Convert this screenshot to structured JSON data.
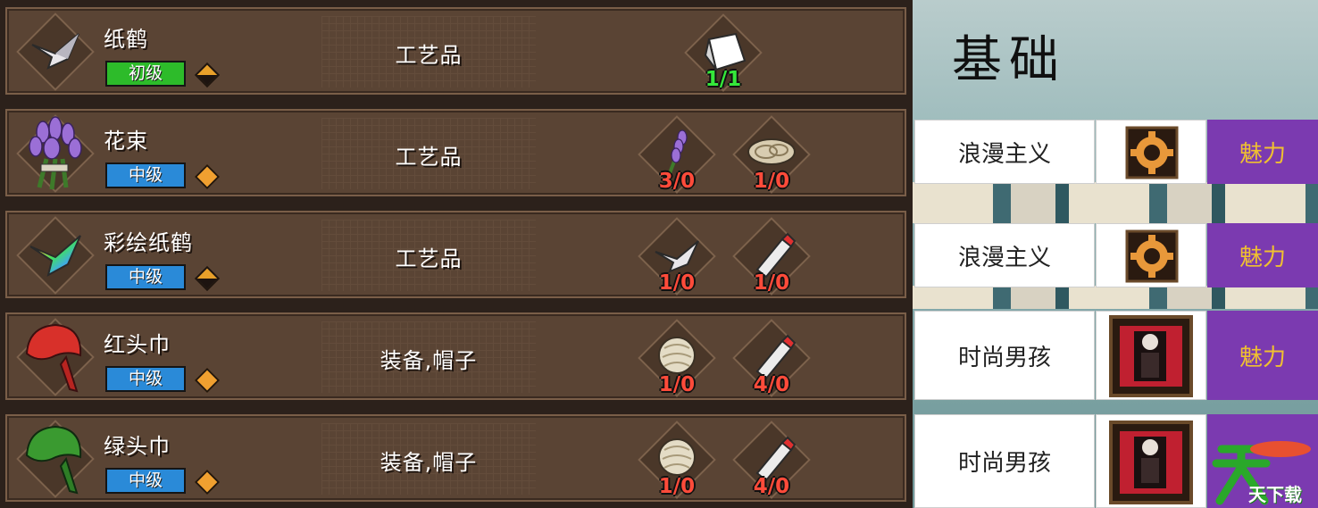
{
  "recipes": [
    {
      "name": "纸鹤",
      "tier": "初级",
      "tier_color": "#2dbb2a",
      "category": "工艺品",
      "icon": "paper-crane-icon",
      "ingredients": [
        {
          "icon": "paper-sheet-icon",
          "count": "1/1",
          "enough": true
        }
      ]
    },
    {
      "name": "花束",
      "tier": "中级",
      "tier_color": "#2a8ad8",
      "category": "工艺品",
      "icon": "lavender-bouquet-icon",
      "ingredients": [
        {
          "icon": "lavender-icon",
          "count": "3/0",
          "enough": false
        },
        {
          "icon": "twine-icon",
          "count": "1/0",
          "enough": false
        }
      ]
    },
    {
      "name": "彩绘纸鹤",
      "tier": "中级",
      "tier_color": "#2a8ad8",
      "category": "工艺品",
      "icon": "rainbow-crane-icon",
      "ingredients": [
        {
          "icon": "paper-crane-icon",
          "count": "1/0",
          "enough": false
        },
        {
          "icon": "paint-tube-icon",
          "count": "1/0",
          "enough": false
        }
      ]
    },
    {
      "name": "红头巾",
      "tier": "中级",
      "tier_color": "#2a8ad8",
      "category": "装备,帽子",
      "icon": "red-bandana-icon",
      "ingredients": [
        {
          "icon": "cloth-roll-icon",
          "count": "1/0",
          "enough": false
        },
        {
          "icon": "paint-tube-icon",
          "count": "4/0",
          "enough": false
        }
      ]
    },
    {
      "name": "绿头巾",
      "tier": "中级",
      "tier_color": "#2a8ad8",
      "category": "装备,帽子",
      "icon": "green-bandana-icon",
      "ingredients": [
        {
          "icon": "cloth-roll-icon",
          "count": "1/0",
          "enough": false
        },
        {
          "icon": "paint-tube-icon",
          "count": "4/0",
          "enough": false
        }
      ]
    }
  ],
  "trait_panel": {
    "heading": "基础",
    "rows": [
      {
        "name": "浪漫主义",
        "icon": "gear-badge-icon",
        "attribute": "魅力"
      },
      {
        "name": "浪漫主义",
        "icon": "gear-badge-icon",
        "attribute": "魅力"
      },
      {
        "name": "时尚男孩",
        "icon": "fashion-portrait-icon",
        "attribute": "魅力"
      },
      {
        "name": "时尚男孩",
        "icon": "fashion-portrait-icon",
        "attribute": ""
      }
    ],
    "attribute_color": "#f0c030",
    "attribute_bg": "#7b3ab0"
  },
  "watermark": {
    "text": "天下载",
    "color": "#2aa82a"
  }
}
